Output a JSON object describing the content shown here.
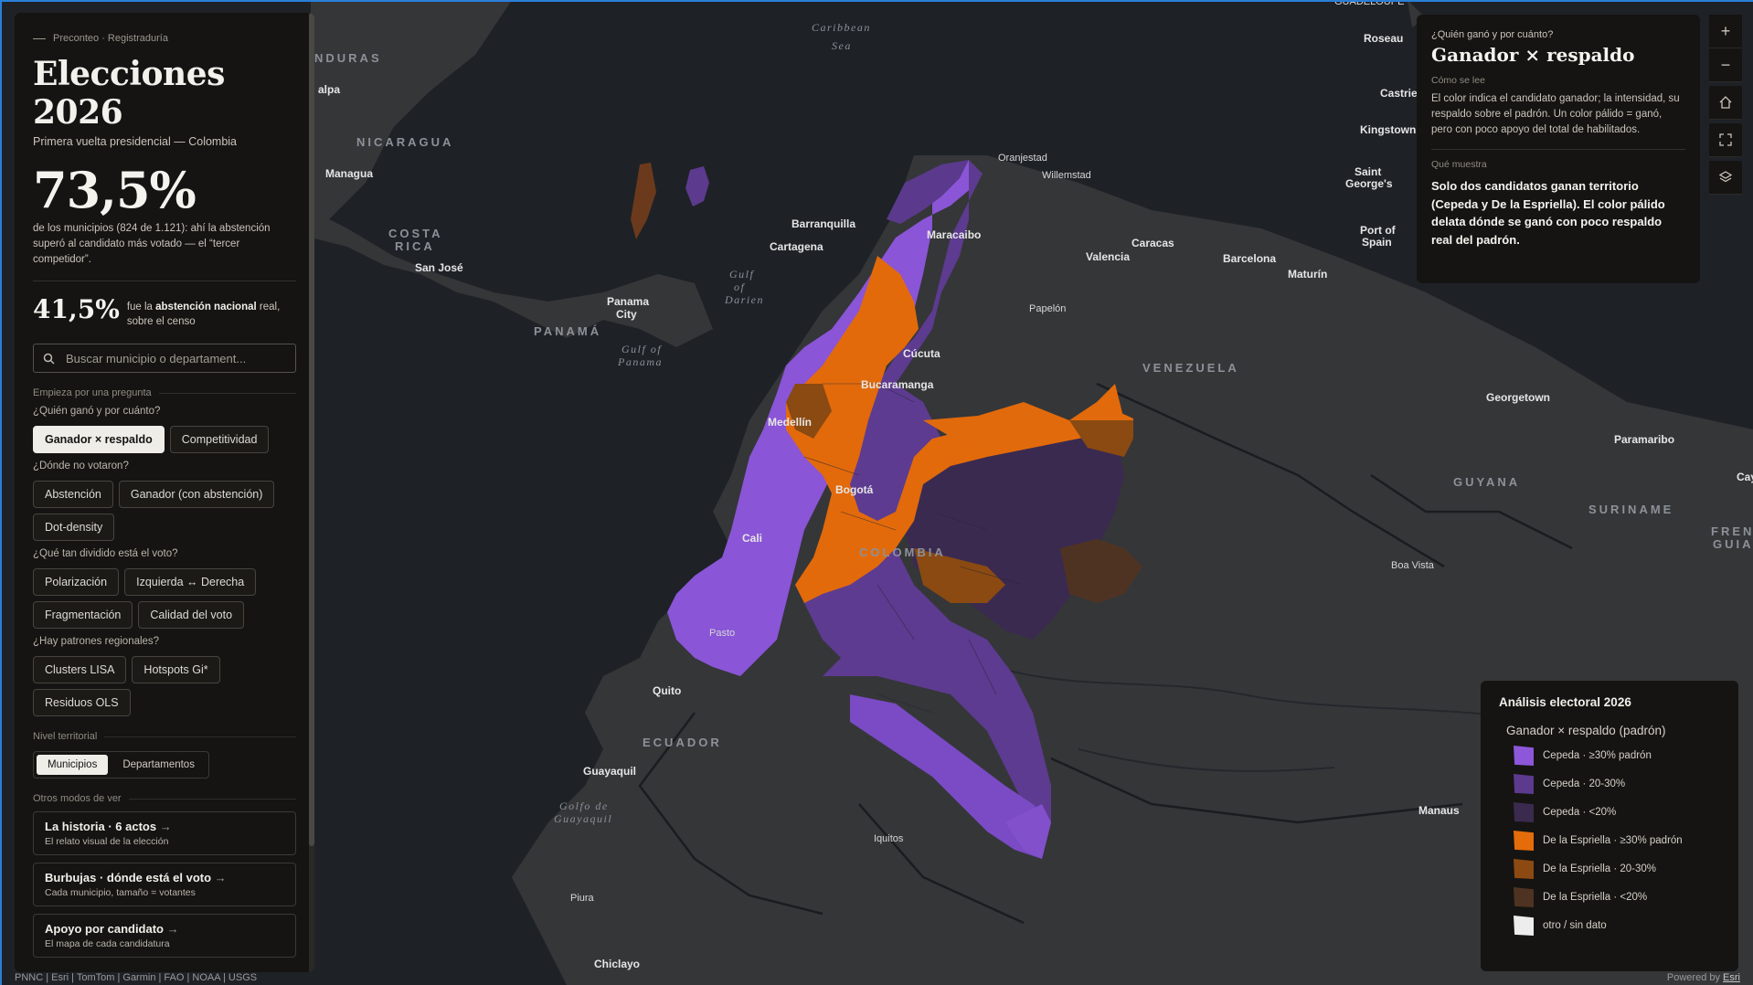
{
  "sidebar": {
    "kicker": "Preconteo · Registraduría",
    "title": "Elecciones 2026",
    "subtitle": "Primera vuelta presidencial — Colombia",
    "headline_value": "73,5%",
    "headline_desc": "de los municipios (824 de 1.121): ahí la abstención superó al candidato más votado — el “tercer competidor”.",
    "national_value": "41,5%",
    "national_desc_pre": "fue la ",
    "national_desc_bold": "abstención nacional",
    "national_desc_post": " real, sobre el censo",
    "search_placeholder": "Buscar municipio o departament...",
    "start_label": "Empieza por una pregunta",
    "q1": "¿Quién ganó y por cuánto?",
    "q1_buttons": [
      "Ganador × respaldo",
      "Competitividad"
    ],
    "q2": "¿Dónde no votaron?",
    "q2_buttons": [
      "Abstención",
      "Ganador (con abstención)",
      "Dot-density"
    ],
    "q3": "¿Qué tan dividido está el voto?",
    "q3_buttons": [
      "Polarización",
      "Izquierda ↔ Derecha",
      "Fragmentación",
      "Calidad del voto"
    ],
    "q4": "¿Hay patrones regionales?",
    "q4_buttons": [
      "Clusters LISA",
      "Hotspots Gi*",
      "Residuos OLS"
    ],
    "level_label": "Nivel territorial",
    "level_options": [
      "Municipios",
      "Departamentos"
    ],
    "modes_label": "Otros modos de ver",
    "cards": [
      {
        "title": "La historia · 6 actos",
        "sub": "El relato visual de la elección"
      },
      {
        "title": "Burbujas · dónde está el voto",
        "sub": "Cada municipio, tamaño = votantes"
      },
      {
        "title": "Apoyo por candidato",
        "sub": "El mapa de cada candidatura"
      }
    ],
    "arrow": "→"
  },
  "info": {
    "question": "¿Quién ganó y por cuánto?",
    "heading": "Ganador × respaldo",
    "how_label": "Cómo se lee",
    "how_text": "El color indica el candidato ganador; la intensidad, su respaldo sobre el padrón. Un color pálido = ganó, pero con poco apoyo del total de habilitados.",
    "shows_label": "Qué muestra",
    "shows_text": "Solo dos candidatos ganan territorio (Cepeda y De la Espriella). El color pálido delata dónde se ganó con poco respaldo real del padrón."
  },
  "tools": [
    "+",
    "−",
    "home-icon",
    "fullscreen-icon",
    "layers-icon"
  ],
  "legend": {
    "title": "Análisis electoral 2026",
    "subtitle": "Ganador × respaldo (padrón)",
    "items": [
      {
        "label": "Cepeda · ≥30% padrón",
        "color": "#8d57d9"
      },
      {
        "label": "Cepeda · 20-30%",
        "color": "#5c3a8e"
      },
      {
        "label": "Cepeda · <20%",
        "color": "#3a2a4e"
      },
      {
        "label": "De la Espriella · ≥30% padrón",
        "color": "#e46c0a"
      },
      {
        "label": "De la Espriella · 20-30%",
        "color": "#8c4a12"
      },
      {
        "label": "De la Espriella · <20%",
        "color": "#4f3322"
      },
      {
        "label": "otro / sin dato",
        "color": "#ededed"
      }
    ]
  },
  "map_labels": {
    "seas": [
      "Caribbean",
      "Sea",
      "Gulf",
      "of",
      "Darien",
      "Gulf of",
      "Panama",
      "Golfo de",
      "Guayaquil"
    ],
    "countries": [
      "NDURAS",
      "NICARAGUA",
      "COSTA",
      "RICA",
      "PANAMÁ",
      "VENEZUELA",
      "COLOMBIA",
      "ECUADOR",
      "GUYANA",
      "SURINAME",
      "FRENCH",
      "GUIANA"
    ],
    "cities": [
      "Roseau",
      "Castries",
      "Kingstown",
      "Saint",
      "George's",
      "Port of",
      "Spain",
      "Oranjestad",
      "Willemstad",
      "Managua",
      "alpa",
      "San José",
      "Barranquilla",
      "Cartagena",
      "Maracaibo",
      "Caracas",
      "Valencia",
      "Barcelona",
      "Maturín",
      "Panama",
      "City",
      "Cúcuta",
      "Papelón",
      "Bucaramanga",
      "Medellín",
      "Georgetown",
      "Paramaribo",
      "Bogotá",
      "Cali",
      "Pasto",
      "Boa Vista",
      "Quito",
      "Guayaquil",
      "Manaus",
      "Iquitos",
      "Piura",
      "Chiclayo",
      "Cay",
      "GUADELOUPE"
    ]
  },
  "attribution": "PNNC | Esri | TomTom | Garmin | FAO | NOAA | USGS",
  "powered_pre": "Powered by ",
  "powered_link": "Esri"
}
